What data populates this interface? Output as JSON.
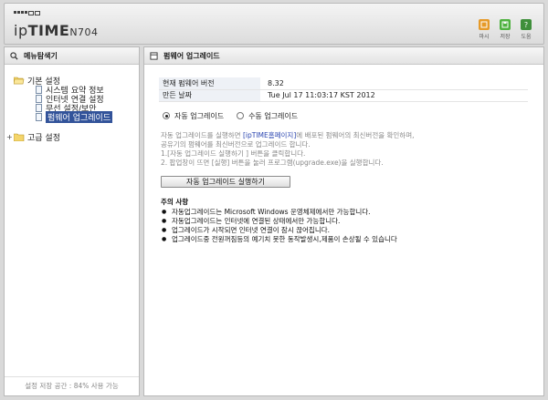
{
  "header": {
    "brand_prefix": "ip",
    "brand_bold": "TIME",
    "brand_model": "N704",
    "buttons": [
      {
        "label": "마시",
        "icon": "home-icon",
        "color": "#e69a28"
      },
      {
        "label": "저장",
        "icon": "save-icon",
        "color": "#4fb240"
      },
      {
        "label": "도움",
        "icon": "help-icon",
        "color": "#3f8f3b"
      }
    ]
  },
  "sidebar": {
    "title": "메뉴탐색기",
    "groups": [
      {
        "label": "기본 설정",
        "items": [
          "시스템 요약 정보",
          "인터넷 연결 설정",
          "무선 설정/보안",
          "펌웨어 업그레이드"
        ]
      },
      {
        "label": "고급 설정",
        "expand": "+"
      }
    ],
    "footer": "설정 저장 공간 : 84% 사용 가능"
  },
  "main": {
    "title": "펌웨어 업그레이드",
    "info": [
      {
        "key": "현재 펌웨어 버전",
        "value": "8.32"
      },
      {
        "key": "만든 날짜",
        "value": "Tue Jul 17 11:03:17 KST 2012"
      }
    ],
    "mode": {
      "auto_label": "자동 업그레이드",
      "manual_label": "수동 업그레이드",
      "selected": "auto"
    },
    "desc": {
      "line1_pre": "자동 업그레이드를 실행하면 ",
      "line1_link": "[ipTIME홈페이지]",
      "line1_post": "에 배포된 펌웨어의 최신버전을 확인하며,",
      "line2": "공유기의 펌웨어를 최신버전으로 업그레이드 합니다.",
      "line3": "1.[자동 업그레이드 실행하기 ] 버튼을 클릭합니다.",
      "line4": "2. 팝업창이 뜨면 [실행] 버튼을 눌러 프로그램(upgrade.exe)을 실행합니다."
    },
    "run_button": "자동 업그레이드 실행하기",
    "notes_title": "주의 사항",
    "notes": [
      "자동업그레이드는 Microsoft Windows 운영체제에서만 가능합니다.",
      "자동업그레이드는 인터넷에 연결된 상태에서만 가능합니다.",
      "업그레이드가 시작되면 인터넷 연결이 잠시 끊어집니다.",
      "업그레이드중 전원꺼짐등의 예기치 못한 동작발생시,제품이 손상될 수 있습니다"
    ]
  }
}
